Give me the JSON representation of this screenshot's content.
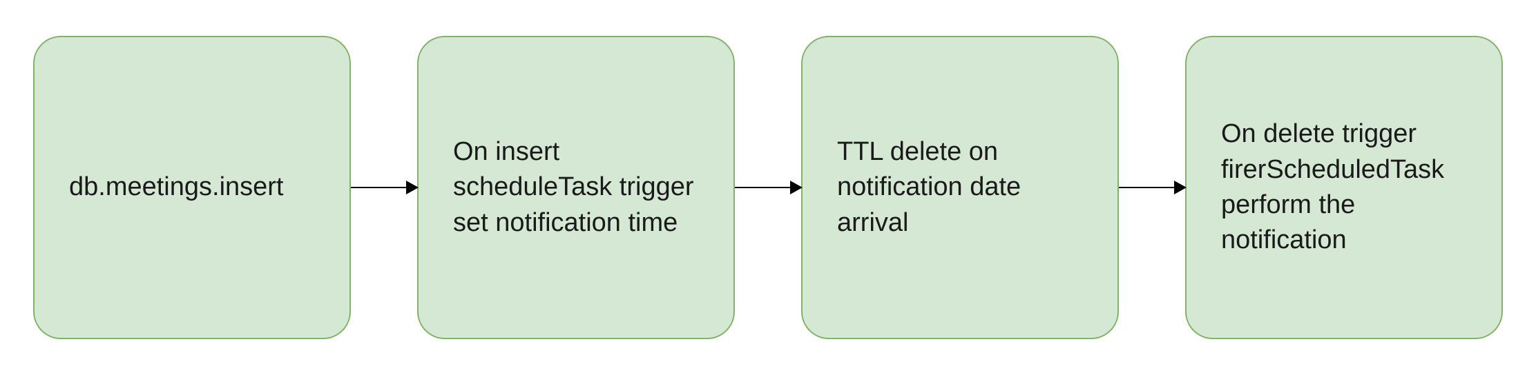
{
  "diagram": {
    "nodes": [
      {
        "id": "node-1",
        "text": "db.meetings.insert"
      },
      {
        "id": "node-2",
        "text": "On insert scheduleTask trigger set notification time"
      },
      {
        "id": "node-3",
        "text": "TTL delete on notification date arrival"
      },
      {
        "id": "node-4",
        "text": "On delete trigger firerScheduledTask perform the notification"
      }
    ],
    "colors": {
      "nodeFill": "#d5e8d4",
      "nodeBorder": "#81b366",
      "arrow": "#000000"
    }
  }
}
